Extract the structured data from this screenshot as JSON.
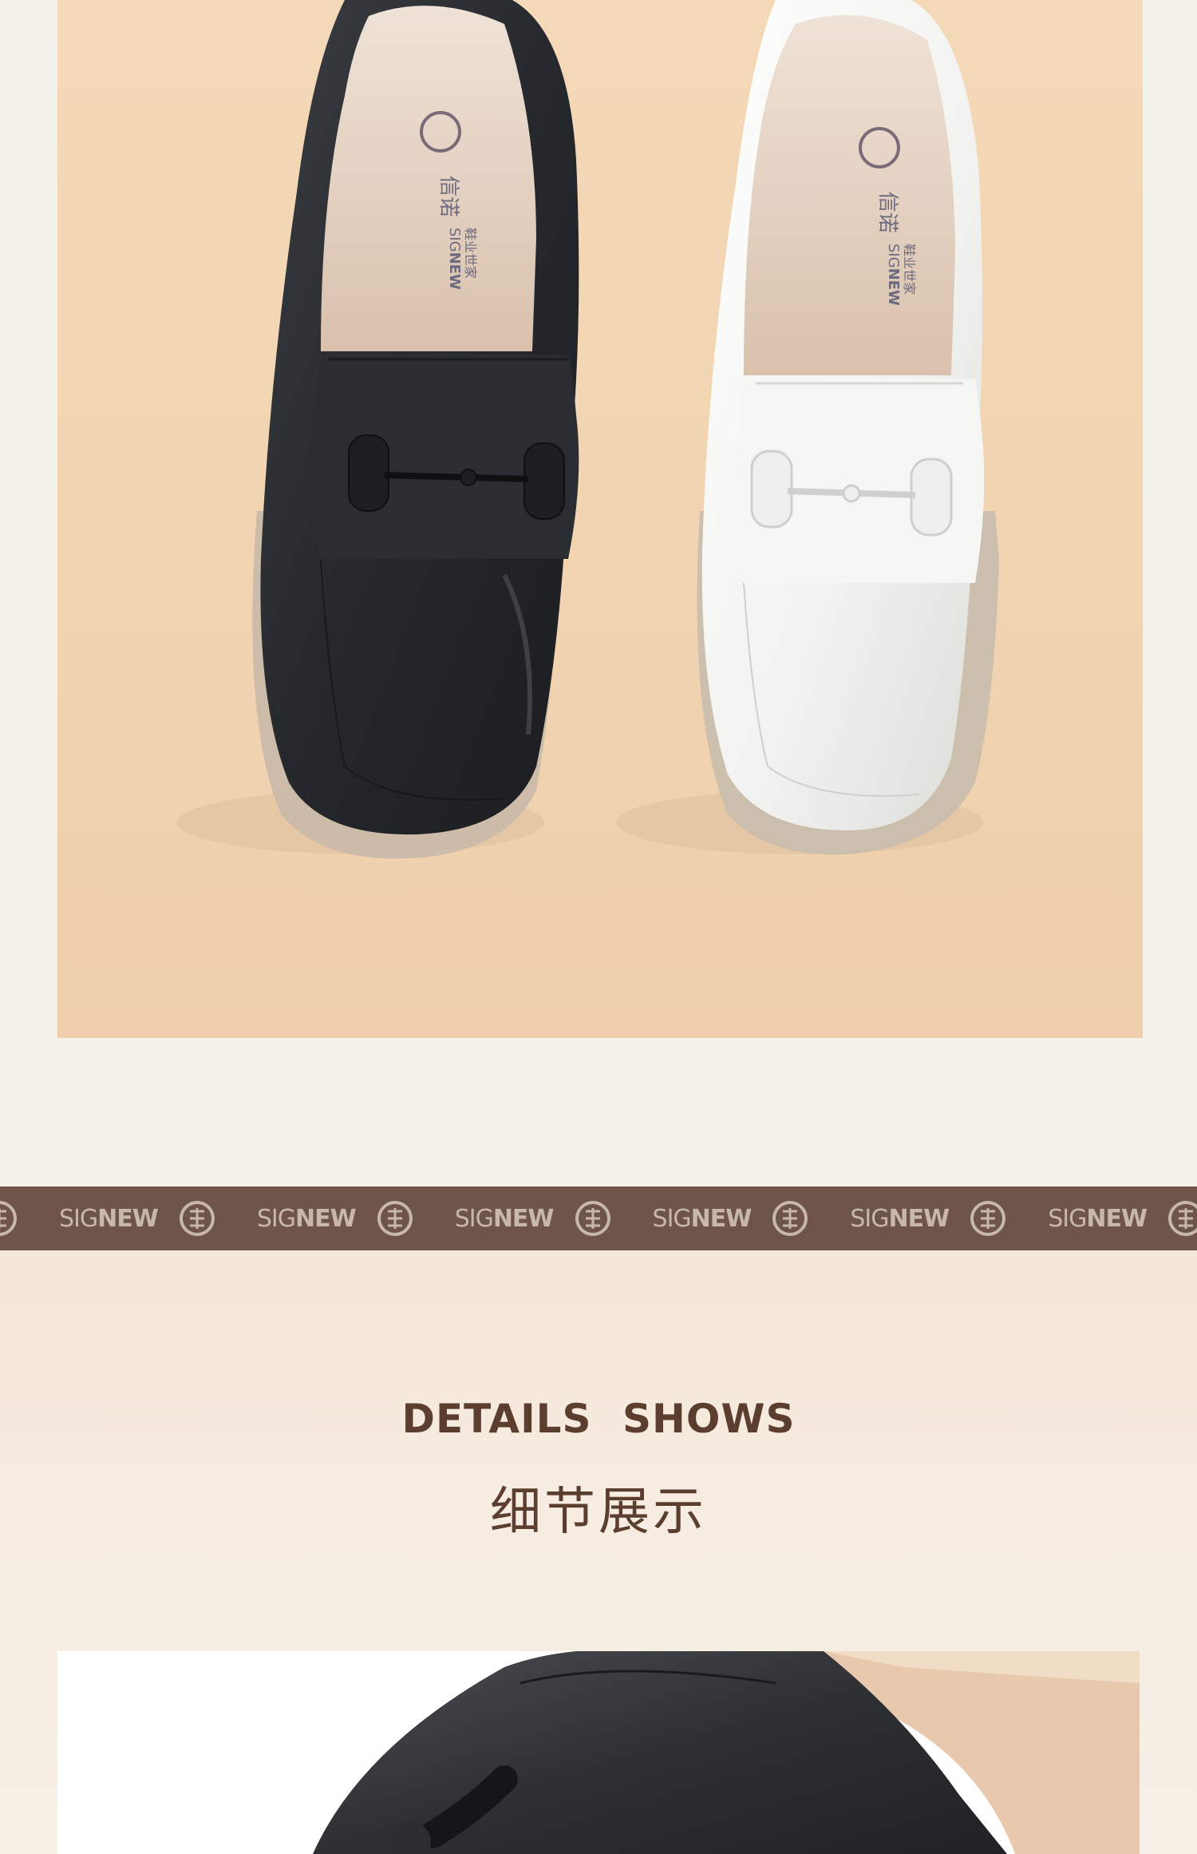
{
  "insole_brand": {
    "name_zh": "信诺",
    "tagline_zh": "鞋业世家",
    "name_en_light": "SIG",
    "name_en_bold": "NEW"
  },
  "brand_strip": {
    "text_light": "SIG",
    "text_bold": "NEW",
    "seal_icon": "signew-seal-icon",
    "repeat_count": 7
  },
  "details": {
    "title_en": "DETAILS SHOWS",
    "title_zh": "细节展示"
  },
  "colors": {
    "strip": "#6e5449",
    "heading": "#5c3e2f",
    "photo_bg": "#f2d4b0",
    "page_bg": "#f4f1eb"
  }
}
